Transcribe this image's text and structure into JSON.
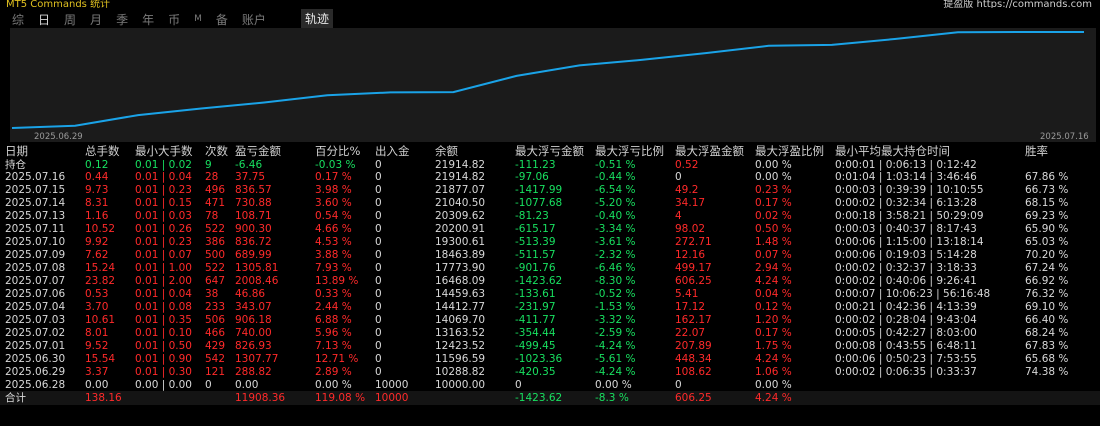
{
  "header": {
    "left_text": "MT5 Commands 统计",
    "right_text": "提盈版 https://commands.com"
  },
  "tabs": [
    "综",
    "日",
    "周",
    "月",
    "季",
    "年",
    "币",
    "M",
    "备",
    "账户"
  ],
  "active_tab": "日",
  "track_tab": "轨迹",
  "colors": {
    "line": "#1aa3e8",
    "profit": "#ff2a2a",
    "loss": "#18e060",
    "panel": "#1b1b1b"
  },
  "chart_data": {
    "type": "line",
    "x_labels": [
      "2025.06.29",
      "2025.07.16"
    ],
    "values": [
      10000.0,
      10288.82,
      11596.59,
      12423.52,
      13163.52,
      14069.7,
      14412.77,
      14459.63,
      16468.09,
      17773.9,
      18463.89,
      19300.61,
      20200.91,
      20309.62,
      21040.5,
      21877.07,
      21914.82,
      21914.82
    ]
  },
  "table": {
    "headers": [
      "日期",
      "总手数",
      "最小大手数",
      "次数",
      "盈亏金额",
      "百分比%",
      "出入金",
      "余额",
      "最大浮亏金额",
      "最大浮亏比例",
      "最大浮盈金额",
      "最大浮盈比例",
      "最小平均最大持仓时间",
      "胜率"
    ],
    "rows": [
      [
        "持仓",
        "0.12",
        "0.01 | 0.02",
        "9",
        "-6.46",
        "-0.03 %",
        "0",
        "21914.82",
        "-111.23",
        "-0.51 %",
        "0.52",
        "0.00 %",
        "0:00:01 | 0:06:13 | 0:12:42",
        ""
      ],
      [
        "2025.07.16",
        "0.44",
        "0.01 | 0.04",
        "28",
        "37.75",
        "0.17 %",
        "0",
        "21914.82",
        "-97.06",
        "-0.44 %",
        "0",
        "0.00 %",
        "0:01:04 | 1:03:14 | 3:46:46",
        "67.86 %"
      ],
      [
        "2025.07.15",
        "9.73",
        "0.01 | 0.23",
        "496",
        "836.57",
        "3.98 %",
        "0",
        "21877.07",
        "-1417.99",
        "-6.54 %",
        "49.2",
        "0.23 %",
        "0:00:03 | 0:39:39 | 10:10:55",
        "66.73 %"
      ],
      [
        "2025.07.14",
        "8.31",
        "0.01 | 0.15",
        "471",
        "730.88",
        "3.60 %",
        "0",
        "21040.50",
        "-1077.68",
        "-5.20 %",
        "34.17",
        "0.17 %",
        "0:00:02 | 0:32:34 | 6:13:28",
        "68.15 %"
      ],
      [
        "2025.07.13",
        "1.16",
        "0.01 | 0.03",
        "78",
        "108.71",
        "0.54 %",
        "0",
        "20309.62",
        "-81.23",
        "-0.40 %",
        "4",
        "0.02 %",
        "0:00:18 | 3:58:21 | 50:29:09",
        "69.23 %"
      ],
      [
        "2025.07.11",
        "10.52",
        "0.01 | 0.26",
        "522",
        "900.30",
        "4.66 %",
        "0",
        "20200.91",
        "-615.17",
        "-3.34 %",
        "98.02",
        "0.50 %",
        "0:00:03 | 0:40:37 | 8:17:43",
        "65.90 %"
      ],
      [
        "2025.07.10",
        "9.92",
        "0.01 | 0.23",
        "386",
        "836.72",
        "4.53 %",
        "0",
        "19300.61",
        "-513.39",
        "-3.61 %",
        "272.71",
        "1.48 %",
        "0:00:06 | 1:15:00 | 13:18:14",
        "65.03 %"
      ],
      [
        "2025.07.09",
        "7.62",
        "0.01 | 0.07",
        "500",
        "689.99",
        "3.88 %",
        "0",
        "18463.89",
        "-511.57",
        "-2.32 %",
        "12.16",
        "0.07 %",
        "0:00:06 | 0:19:03 | 5:14:28",
        "70.20 %"
      ],
      [
        "2025.07.08",
        "15.24",
        "0.01 | 1.00",
        "522",
        "1305.81",
        "7.93 %",
        "0",
        "17773.90",
        "-901.76",
        "-6.46 %",
        "499.17",
        "2.94 %",
        "0:00:02 | 0:32:37 | 3:18:33",
        "67.24 %"
      ],
      [
        "2025.07.07",
        "23.82",
        "0.01 | 2.00",
        "647",
        "2008.46",
        "13.89 %",
        "0",
        "16468.09",
        "-1423.62",
        "-8.30 %",
        "606.25",
        "4.24 %",
        "0:00:02 | 0:40:06 | 9:26:41",
        "66.92 %"
      ],
      [
        "2025.07.06",
        "0.53",
        "0.01 | 0.04",
        "38",
        "46.86",
        "0.33 %",
        "0",
        "14459.63",
        "-133.61",
        "-0.52 %",
        "5.41",
        "0.04 %",
        "0:00:07 | 10:06:23 | 56:16:48",
        "76.32 %"
      ],
      [
        "2025.07.04",
        "3.70",
        "0.01 | 0.08",
        "233",
        "343.07",
        "2.44 %",
        "0",
        "14412.77",
        "-231.97",
        "-1.53 %",
        "17.12",
        "0.12 %",
        "0:00:21 | 0:42:36 | 4:13:39",
        "69.10 %"
      ],
      [
        "2025.07.03",
        "10.61",
        "0.01 | 0.35",
        "506",
        "906.18",
        "6.88 %",
        "0",
        "14069.70",
        "-411.77",
        "-3.32 %",
        "162.17",
        "1.20 %",
        "0:00:02 | 0:28:04 | 9:43:04",
        "66.40 %"
      ],
      [
        "2025.07.02",
        "8.01",
        "0.01 | 0.10",
        "466",
        "740.00",
        "5.96 %",
        "0",
        "13163.52",
        "-354.44",
        "-2.59 %",
        "22.07",
        "0.17 %",
        "0:00:05 | 0:42:27 | 8:03:00",
        "68.24 %"
      ],
      [
        "2025.07.01",
        "9.52",
        "0.01 | 0.50",
        "429",
        "826.93",
        "7.13 %",
        "0",
        "12423.52",
        "-499.45",
        "-4.24 %",
        "207.89",
        "1.75 %",
        "0:00:08 | 0:43:55 | 6:48:11",
        "67.83 %"
      ],
      [
        "2025.06.30",
        "15.54",
        "0.01 | 0.90",
        "542",
        "1307.77",
        "12.71 %",
        "0",
        "11596.59",
        "-1023.36",
        "-5.61 %",
        "448.34",
        "4.24 %",
        "0:00:06 | 0:50:23 | 7:53:55",
        "65.68 %"
      ],
      [
        "2025.06.29",
        "3.37",
        "0.01 | 0.30",
        "121",
        "288.82",
        "2.89 %",
        "0",
        "10288.82",
        "-420.35",
        "-4.24 %",
        "108.62",
        "1.06 %",
        "0:00:02 | 0:06:35 | 0:33:37",
        "74.38 %"
      ],
      [
        "2025.06.28",
        "0.00",
        "0.00 | 0.00",
        "0",
        "0.00",
        "0.00 %",
        "10000",
        "10000.00",
        "0",
        "0.00 %",
        "0",
        "0.00 %",
        "",
        ""
      ]
    ],
    "total": [
      "合计",
      "138.16",
      "",
      "",
      "11908.36",
      "119.08 %",
      "10000",
      "",
      "-1423.62",
      "-8.3 %",
      "606.25",
      "4.24 %",
      "",
      ""
    ]
  }
}
